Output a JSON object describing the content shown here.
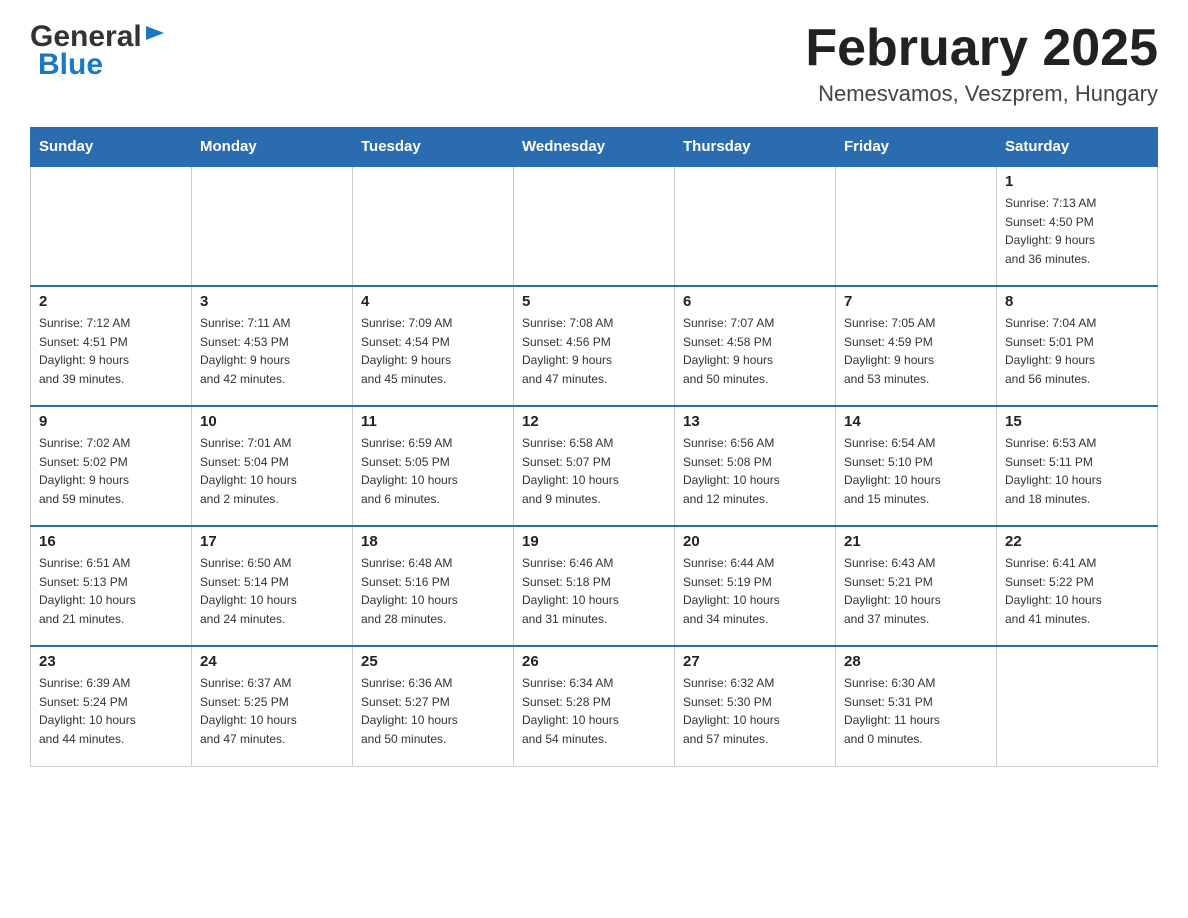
{
  "header": {
    "logo_line1": "General",
    "logo_line2": "Blue",
    "title": "February 2025",
    "subtitle": "Nemesvamos, Veszprem, Hungary"
  },
  "weekdays": [
    "Sunday",
    "Monday",
    "Tuesday",
    "Wednesday",
    "Thursday",
    "Friday",
    "Saturday"
  ],
  "weeks": [
    [
      {
        "day": "",
        "info": ""
      },
      {
        "day": "",
        "info": ""
      },
      {
        "day": "",
        "info": ""
      },
      {
        "day": "",
        "info": ""
      },
      {
        "day": "",
        "info": ""
      },
      {
        "day": "",
        "info": ""
      },
      {
        "day": "1",
        "info": "Sunrise: 7:13 AM\nSunset: 4:50 PM\nDaylight: 9 hours\nand 36 minutes."
      }
    ],
    [
      {
        "day": "2",
        "info": "Sunrise: 7:12 AM\nSunset: 4:51 PM\nDaylight: 9 hours\nand 39 minutes."
      },
      {
        "day": "3",
        "info": "Sunrise: 7:11 AM\nSunset: 4:53 PM\nDaylight: 9 hours\nand 42 minutes."
      },
      {
        "day": "4",
        "info": "Sunrise: 7:09 AM\nSunset: 4:54 PM\nDaylight: 9 hours\nand 45 minutes."
      },
      {
        "day": "5",
        "info": "Sunrise: 7:08 AM\nSunset: 4:56 PM\nDaylight: 9 hours\nand 47 minutes."
      },
      {
        "day": "6",
        "info": "Sunrise: 7:07 AM\nSunset: 4:58 PM\nDaylight: 9 hours\nand 50 minutes."
      },
      {
        "day": "7",
        "info": "Sunrise: 7:05 AM\nSunset: 4:59 PM\nDaylight: 9 hours\nand 53 minutes."
      },
      {
        "day": "8",
        "info": "Sunrise: 7:04 AM\nSunset: 5:01 PM\nDaylight: 9 hours\nand 56 minutes."
      }
    ],
    [
      {
        "day": "9",
        "info": "Sunrise: 7:02 AM\nSunset: 5:02 PM\nDaylight: 9 hours\nand 59 minutes."
      },
      {
        "day": "10",
        "info": "Sunrise: 7:01 AM\nSunset: 5:04 PM\nDaylight: 10 hours\nand 2 minutes."
      },
      {
        "day": "11",
        "info": "Sunrise: 6:59 AM\nSunset: 5:05 PM\nDaylight: 10 hours\nand 6 minutes."
      },
      {
        "day": "12",
        "info": "Sunrise: 6:58 AM\nSunset: 5:07 PM\nDaylight: 10 hours\nand 9 minutes."
      },
      {
        "day": "13",
        "info": "Sunrise: 6:56 AM\nSunset: 5:08 PM\nDaylight: 10 hours\nand 12 minutes."
      },
      {
        "day": "14",
        "info": "Sunrise: 6:54 AM\nSunset: 5:10 PM\nDaylight: 10 hours\nand 15 minutes."
      },
      {
        "day": "15",
        "info": "Sunrise: 6:53 AM\nSunset: 5:11 PM\nDaylight: 10 hours\nand 18 minutes."
      }
    ],
    [
      {
        "day": "16",
        "info": "Sunrise: 6:51 AM\nSunset: 5:13 PM\nDaylight: 10 hours\nand 21 minutes."
      },
      {
        "day": "17",
        "info": "Sunrise: 6:50 AM\nSunset: 5:14 PM\nDaylight: 10 hours\nand 24 minutes."
      },
      {
        "day": "18",
        "info": "Sunrise: 6:48 AM\nSunset: 5:16 PM\nDaylight: 10 hours\nand 28 minutes."
      },
      {
        "day": "19",
        "info": "Sunrise: 6:46 AM\nSunset: 5:18 PM\nDaylight: 10 hours\nand 31 minutes."
      },
      {
        "day": "20",
        "info": "Sunrise: 6:44 AM\nSunset: 5:19 PM\nDaylight: 10 hours\nand 34 minutes."
      },
      {
        "day": "21",
        "info": "Sunrise: 6:43 AM\nSunset: 5:21 PM\nDaylight: 10 hours\nand 37 minutes."
      },
      {
        "day": "22",
        "info": "Sunrise: 6:41 AM\nSunset: 5:22 PM\nDaylight: 10 hours\nand 41 minutes."
      }
    ],
    [
      {
        "day": "23",
        "info": "Sunrise: 6:39 AM\nSunset: 5:24 PM\nDaylight: 10 hours\nand 44 minutes."
      },
      {
        "day": "24",
        "info": "Sunrise: 6:37 AM\nSunset: 5:25 PM\nDaylight: 10 hours\nand 47 minutes."
      },
      {
        "day": "25",
        "info": "Sunrise: 6:36 AM\nSunset: 5:27 PM\nDaylight: 10 hours\nand 50 minutes."
      },
      {
        "day": "26",
        "info": "Sunrise: 6:34 AM\nSunset: 5:28 PM\nDaylight: 10 hours\nand 54 minutes."
      },
      {
        "day": "27",
        "info": "Sunrise: 6:32 AM\nSunset: 5:30 PM\nDaylight: 10 hours\nand 57 minutes."
      },
      {
        "day": "28",
        "info": "Sunrise: 6:30 AM\nSunset: 5:31 PM\nDaylight: 11 hours\nand 0 minutes."
      },
      {
        "day": "",
        "info": ""
      }
    ]
  ]
}
